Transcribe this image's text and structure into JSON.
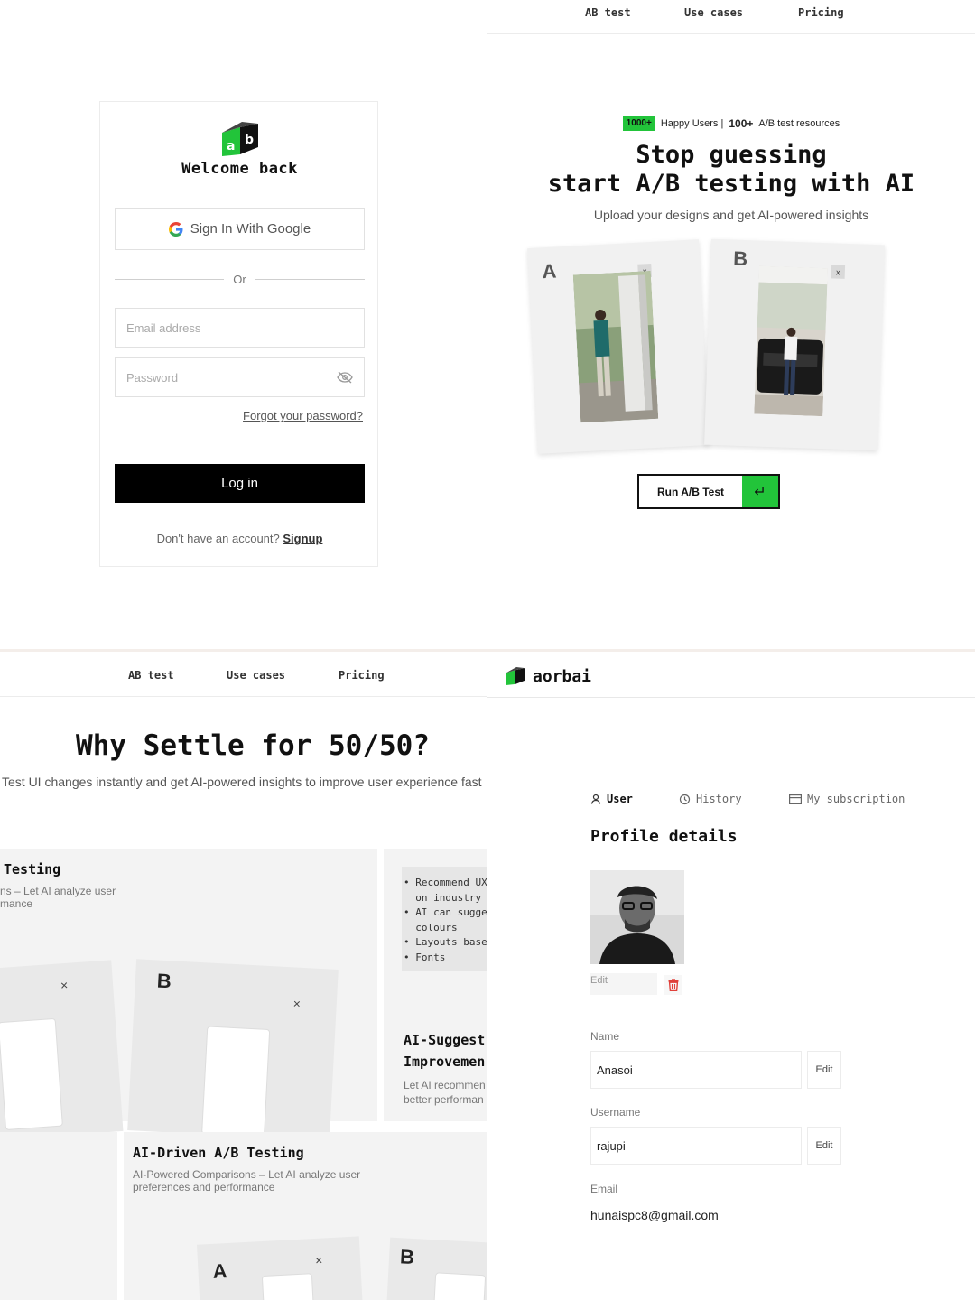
{
  "nav": {
    "ab_test": "AB test",
    "use_cases": "Use cases",
    "pricing": "Pricing"
  },
  "login": {
    "title": "Welcome back",
    "google_button": "Sign In With Google",
    "or": "Or",
    "email_placeholder": "Email address",
    "password_placeholder": "Password",
    "forgot": "Forgot your password?",
    "login_button": "Log in",
    "no_account": "Don't have an account?",
    "signup": "Signup"
  },
  "hero": {
    "badge": "1000+",
    "happy_users": "Happy Users |",
    "resources_count": "100+",
    "resources_label": "A/B test resources",
    "title_line1": "Stop guessing",
    "title_line2": "start A/B testing with AI",
    "subtitle": "Upload your designs and get AI-powered insights",
    "card_a": "A",
    "card_b": "B",
    "close": "x",
    "run_button": "Run A/B Test",
    "enter_icon": "↵"
  },
  "features": {
    "title": "Why Settle for 50/50?",
    "subtitle": "Test UI changes instantly and get AI-powered insights to improve user experience fast",
    "card1_title": "Testing",
    "card1_desc_line1": "ns – Let AI analyze user",
    "card1_desc_line2": "mance",
    "bullets": [
      "Recommend UX",
      "on industry t",
      "AI can sugges",
      "colours",
      "Layouts based",
      "Fonts"
    ],
    "card2_title_line1": "AI-Suggest",
    "card2_title_line2": "Improvemen",
    "card2_desc_line1": "Let AI recommen",
    "card2_desc_line2": "better performan",
    "card3_title": "AI-Driven A/B Testing",
    "card3_desc_line1": "AI-Powered Comparisons – Let AI analyze user",
    "card3_desc_line2": "preferences and performance",
    "letter_a": "A",
    "letter_b": "B",
    "close": "×"
  },
  "profile": {
    "brand": "aorbai",
    "tabs": {
      "user": "User",
      "history": "History",
      "subscription": "My subscription"
    },
    "title": "Profile details",
    "edit_label": "Edit",
    "name_label": "Name",
    "name_value": "Anasoi",
    "username_label": "Username",
    "username_value": "rajupi",
    "email_label": "Email",
    "email_value": "hunaispc8@gmail.com",
    "field_edit": "Edit"
  },
  "colors": {
    "accent_green": "#22c43a",
    "black": "#000000",
    "danger": "#e0403a"
  }
}
